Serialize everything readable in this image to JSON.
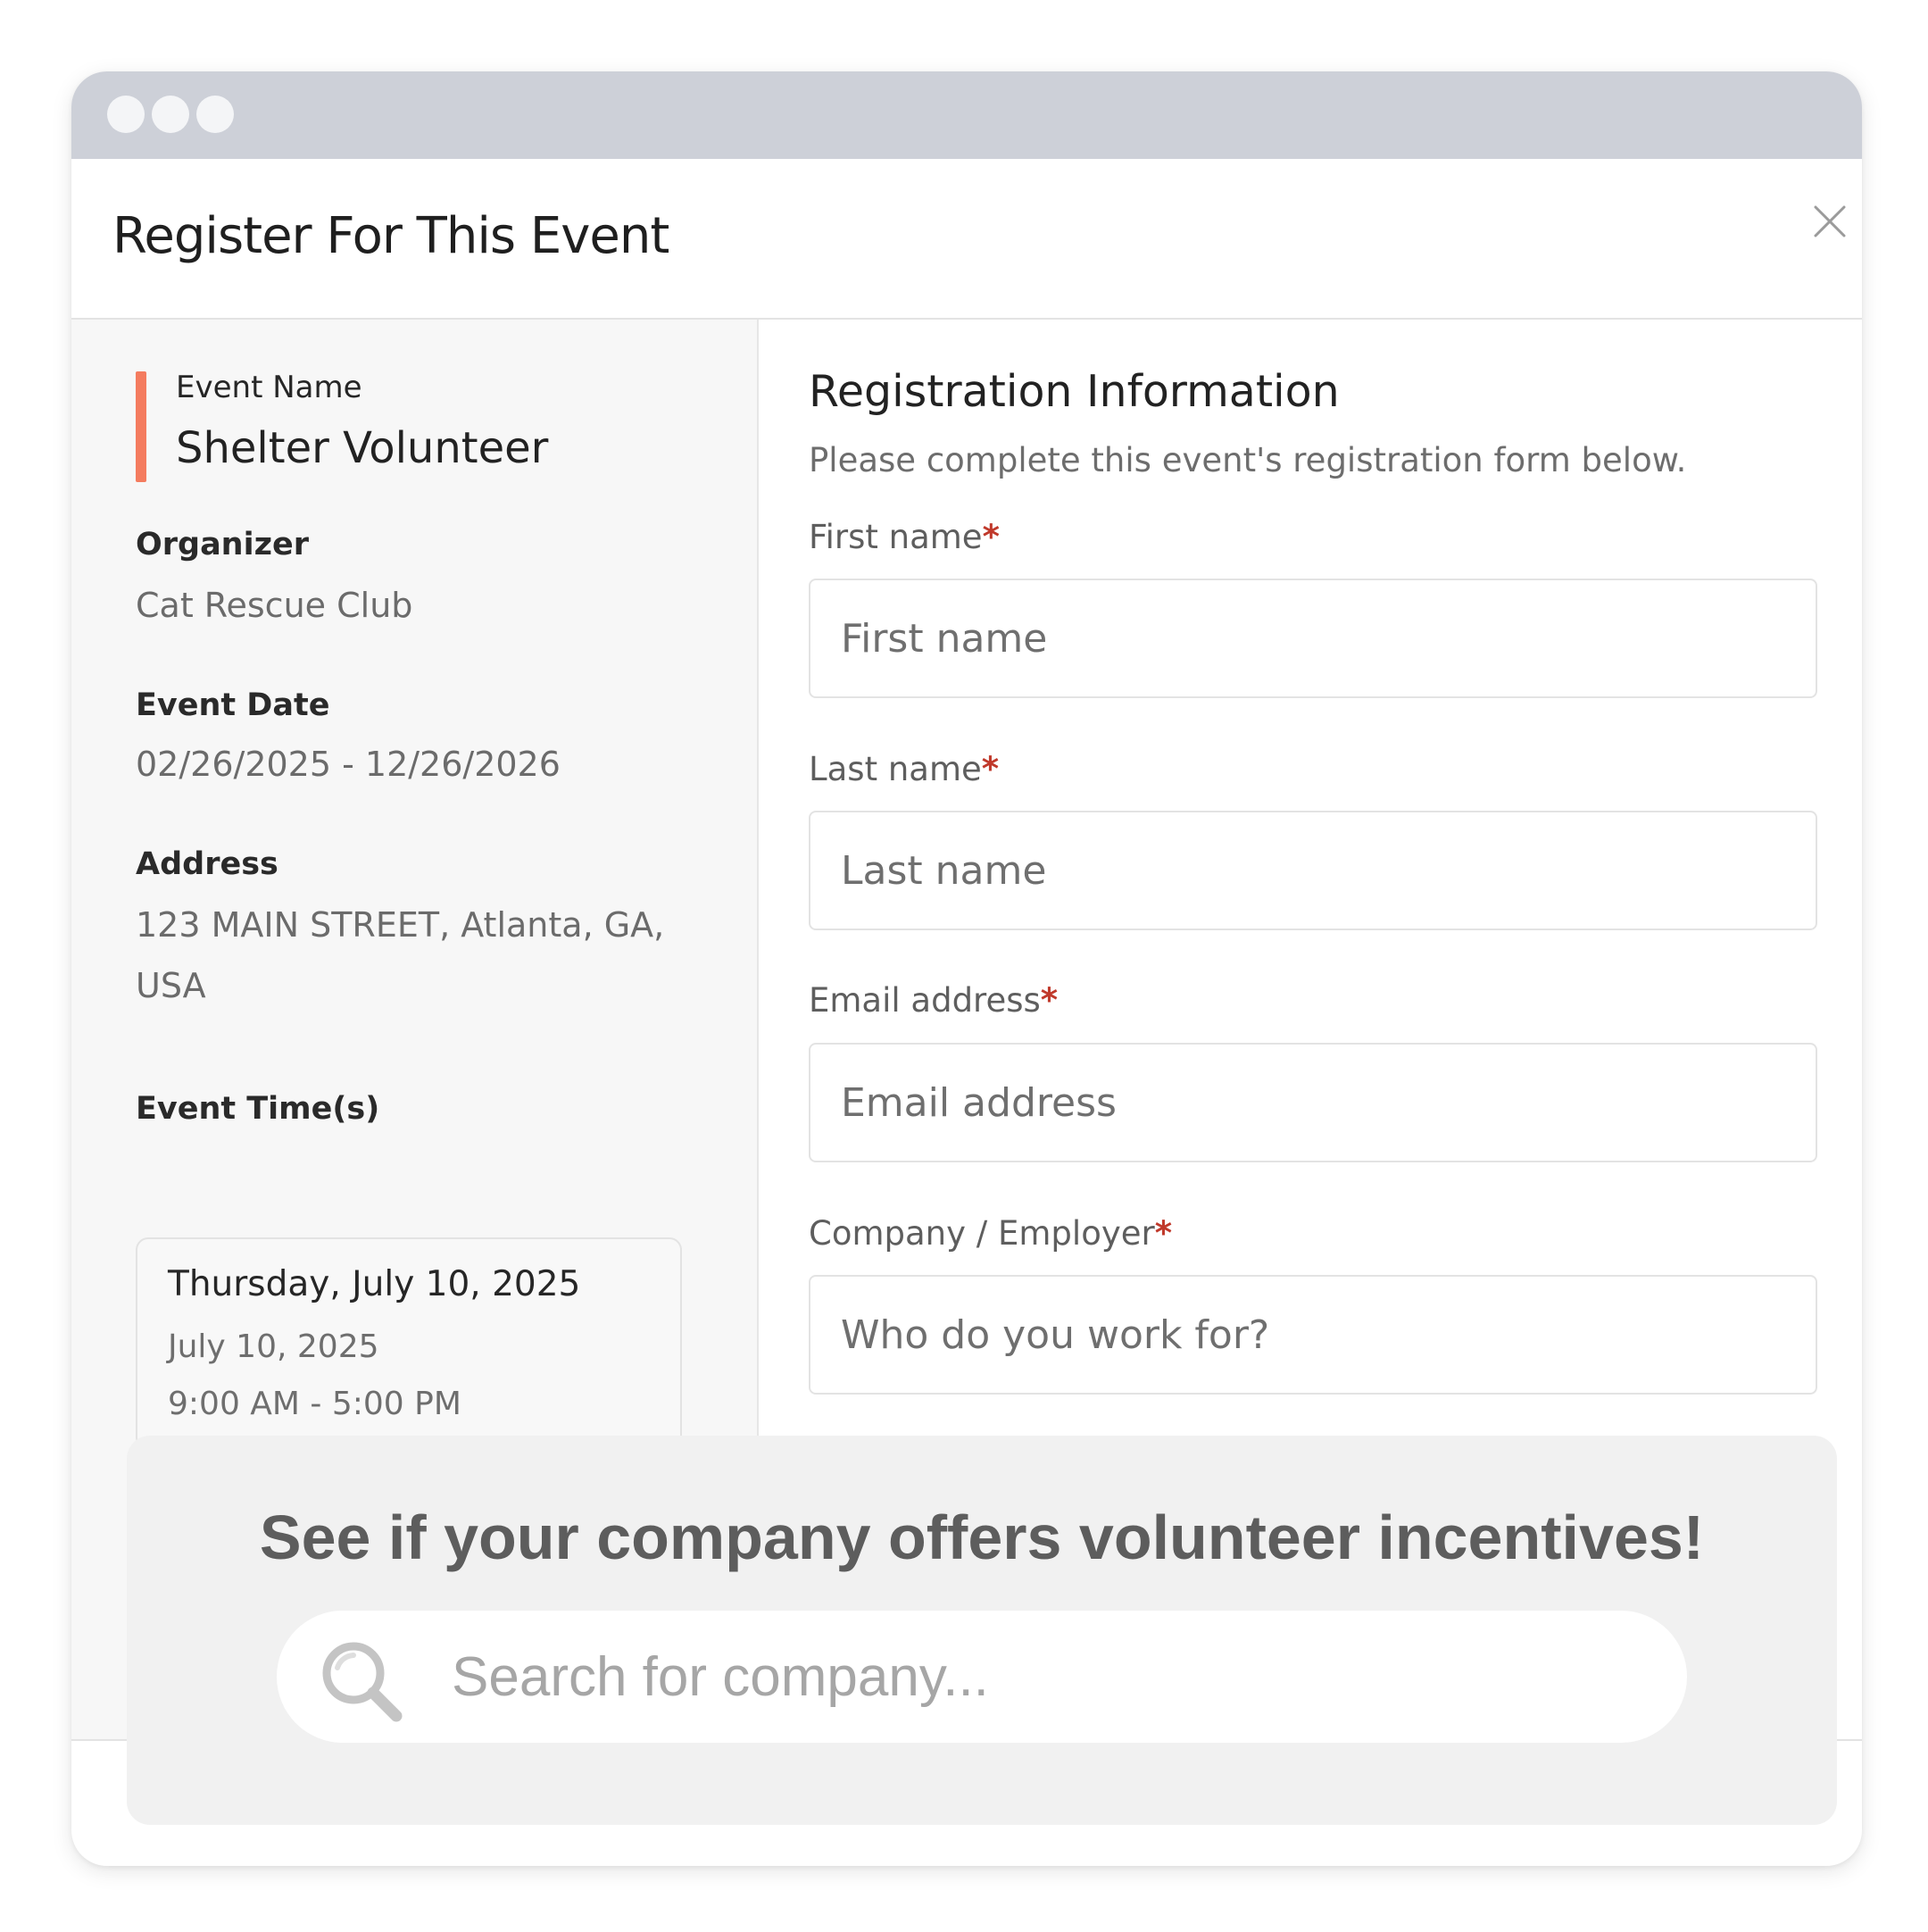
{
  "colors": {
    "accent": "#f47c5f",
    "required": "#c0392b"
  },
  "dialog": {
    "title": "Register For This Event"
  },
  "event": {
    "name_label": "Event Name",
    "name": "Shelter Volunteer",
    "organizer_label": "Organizer",
    "organizer": "Cat Rescue Club",
    "date_label": "Event Date",
    "date_range": "02/26/2025 - 12/26/2026",
    "address_label": "Address",
    "address_line1": "123 MAIN STREET, Atlanta, GA,",
    "address_line2": "USA",
    "times_label": "Event Time(s)",
    "times": [
      {
        "day": "Thursday, July 10, 2025",
        "date": "July 10, 2025",
        "hours": "9:00 AM - 5:00 PM"
      }
    ]
  },
  "registration": {
    "title": "Registration Information",
    "description": "Please complete this event's registration form below.",
    "fields": [
      {
        "label": "First name",
        "required_mark": "*",
        "placeholder": "First name",
        "value": ""
      },
      {
        "label": "Last name",
        "required_mark": "*",
        "placeholder": "Last name",
        "value": ""
      },
      {
        "label": "Email address",
        "required_mark": "*",
        "placeholder": "Email address",
        "value": ""
      },
      {
        "label": "Company / Employer",
        "required_mark": "*",
        "placeholder": "Who do you work for?",
        "value": ""
      }
    ]
  },
  "promo": {
    "heading": "See if your company offers volunteer incentives!",
    "search_placeholder": "Search for company...",
    "search_value": ""
  },
  "icons": {
    "close": "close-icon",
    "search": "search-icon"
  }
}
